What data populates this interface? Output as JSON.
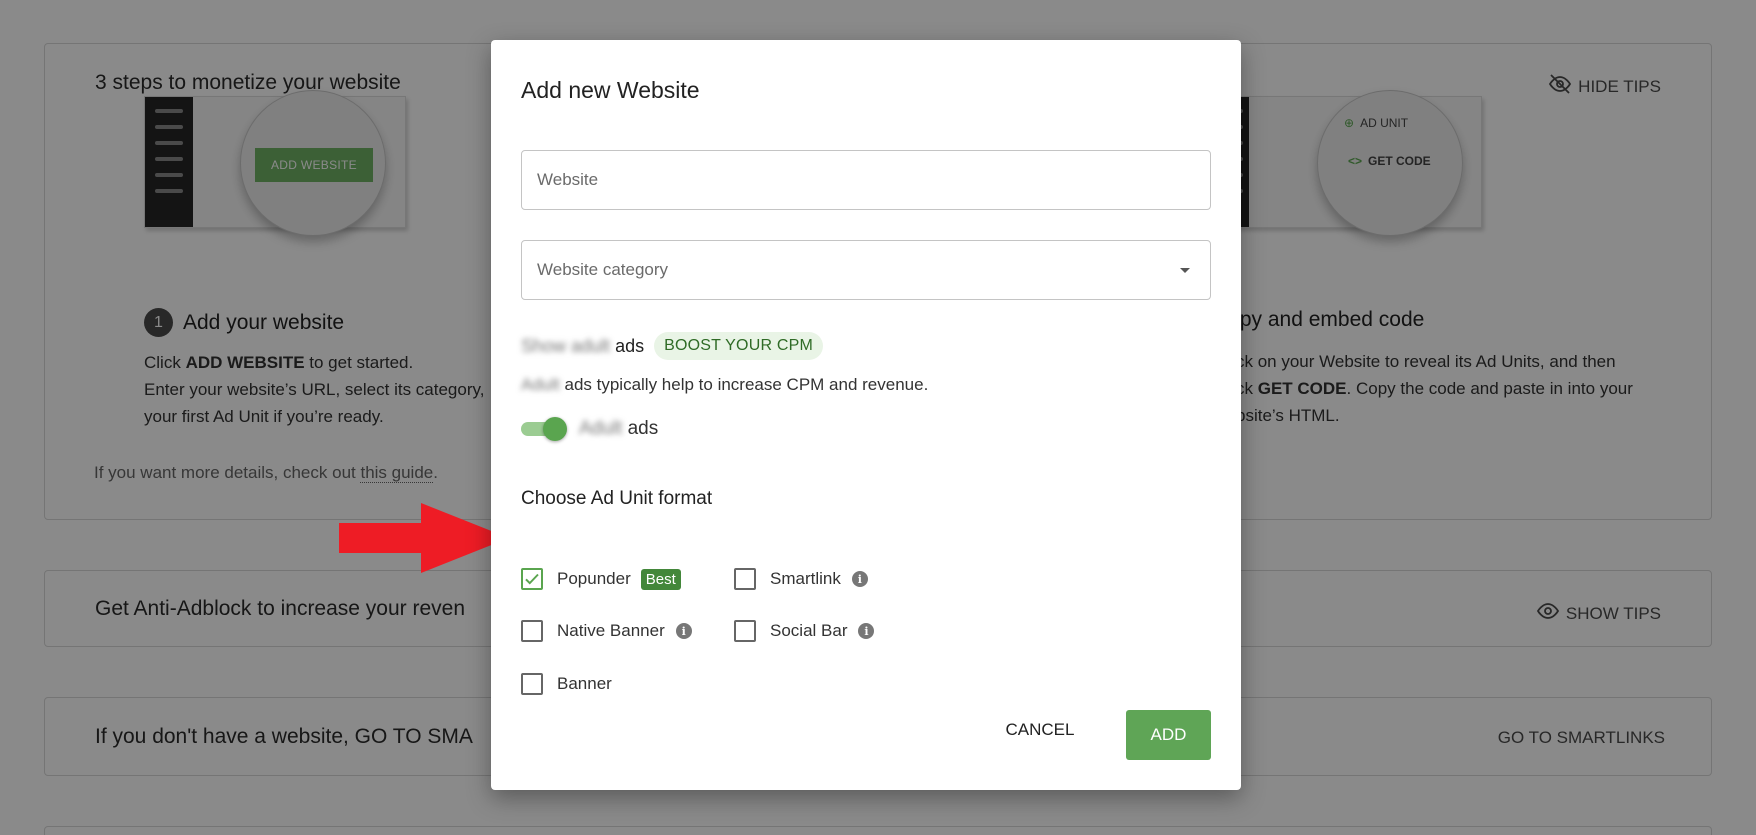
{
  "background": {
    "steps_card": {
      "title": "3 steps to monetize your website",
      "hide_tips": "HIDE TIPS",
      "illus1_button": "ADD WEBSITE",
      "illus3_line1": "AD UNIT",
      "illus3_line2": "GET CODE",
      "step1": {
        "num": "1",
        "title": "Add your website",
        "line1_pre": "Click ",
        "line1_bold": "ADD WEBSITE",
        "line1_post": " to get started.",
        "line2": "Enter your website’s URL, select its category,",
        "line3": "your first Ad Unit if you’re ready."
      },
      "step3": {
        "title": "Copy and embed code",
        "line1": "ck on your Website to reveal its Ad Units, and then",
        "line2_pre": "ck ",
        "line2_bold": "GET CODE",
        "line2_post": ". Copy the code and paste in into your",
        "line3": "bsite’s HTML."
      },
      "guide_pre": "If you want more details, check out ",
      "guide_link": "this guide",
      "guide_post": "."
    },
    "anti_card": {
      "title": "Get Anti-Adblock to increase your reven",
      "show_tips": "SHOW TIPS"
    },
    "noweb_card": {
      "title": "If you don't have a website, GO TO SMA",
      "action": "GO TO SMARTLINKS"
    }
  },
  "modal": {
    "title": "Add new Website",
    "website_placeholder": "Website",
    "category_placeholder": "Website category",
    "adult_heading_blur": "Show adult",
    "adult_heading_rest": "ads",
    "boost_badge": "BOOST YOUR CPM",
    "adult_desc_blur": "Adult",
    "adult_desc_rest": "ads typically help to increase CPM and revenue.",
    "toggle_on": true,
    "toggle_label_blur": "Adult",
    "toggle_label_rest": "ads",
    "format_title": "Choose Ad Unit format",
    "options": {
      "popunder": {
        "label": "Popunder",
        "checked": true,
        "badge": "Best"
      },
      "smartlink": {
        "label": "Smartlink",
        "checked": false
      },
      "native": {
        "label": "Native Banner",
        "checked": false
      },
      "social": {
        "label": "Social Bar",
        "checked": false
      },
      "banner": {
        "label": "Banner",
        "checked": false
      }
    },
    "info_glyph": "i",
    "cancel_label": "CANCEL",
    "add_label": "ADD"
  },
  "colors": {
    "accent_green": "#5fa556",
    "best_badge": "#43873a",
    "boost_bg": "#e9f4e6",
    "arrow_red": "#ee1c25"
  }
}
